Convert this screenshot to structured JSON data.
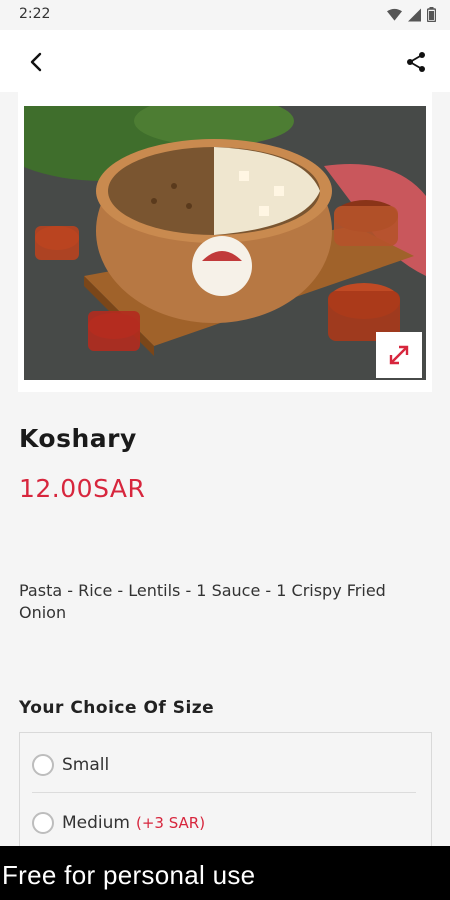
{
  "status_bar": {
    "time": "2:22",
    "icons": [
      "wifi-icon",
      "signal-icon",
      "battery-icon"
    ]
  },
  "app_bar": {
    "back_icon": "back-arrow-icon",
    "share_icon": "share-icon"
  },
  "product": {
    "image_alt": "Koshary bowl with sauces",
    "expand_icon": "expand-icon",
    "name": "Koshary",
    "price": "12.00SAR",
    "description": "Pasta - Rice - Lentils - 1 Sauce - 1 Crispy Fried Onion"
  },
  "size_options": {
    "heading": "Your Choice Of Size",
    "options": [
      {
        "label": "Small",
        "extra": ""
      },
      {
        "label": "Medium",
        "extra": "(+3 SAR)"
      }
    ]
  },
  "watermark": {
    "text": "Free for personal use"
  },
  "colors": {
    "accent": "#d7263d",
    "background": "#f5f5f5"
  }
}
